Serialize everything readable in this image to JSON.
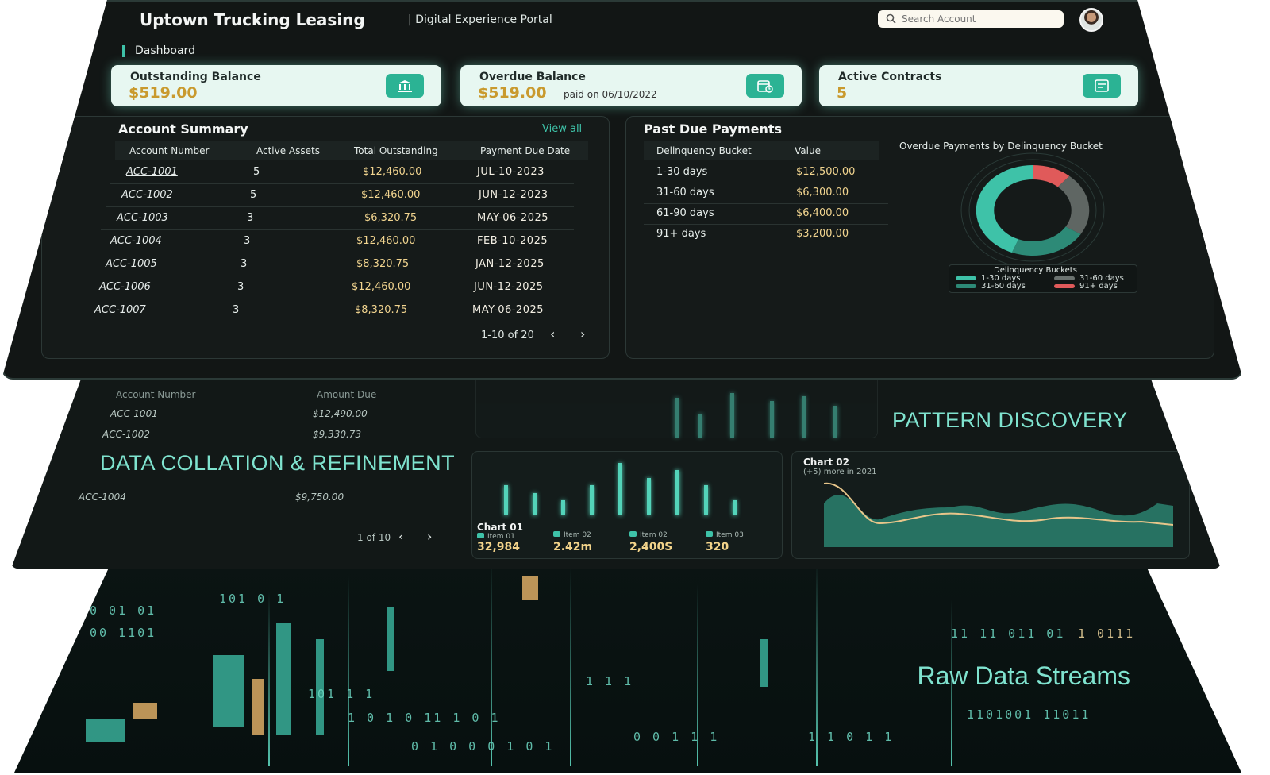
{
  "header": {
    "app_title": "Uptown Trucking Leasing",
    "portal_subtitle": "| Digital Experience Portal",
    "search_placeholder": "Search Account"
  },
  "breadcrumb": "Dashboard",
  "cards": [
    {
      "label": "Outstanding Balance",
      "value": "$519.00",
      "icon": "bank-icon"
    },
    {
      "label": "Overdue Balance",
      "value": "$519.00",
      "note": "paid on 06/10/2022",
      "icon": "calendar-clock-icon"
    },
    {
      "label": "Active Contracts",
      "value": "5",
      "icon": "contract-icon"
    }
  ],
  "account_summary": {
    "title": "Account Summary",
    "view_all": "View all",
    "columns": [
      "Account Number",
      "Active Assets",
      "Total Outstanding",
      "Payment Due Date"
    ],
    "rows": [
      {
        "account": "ACC-1001",
        "assets": "5",
        "outstanding": "$12,460.00",
        "due": "JUL-10-2023"
      },
      {
        "account": "ACC-1002",
        "assets": "5",
        "outstanding": "$12,460.00",
        "due": "JUN-12-2023"
      },
      {
        "account": "ACC-1003",
        "assets": "3",
        "outstanding": "$6,320.75",
        "due": "MAY-06-2025"
      },
      {
        "account": "ACC-1004",
        "assets": "3",
        "outstanding": "$12,460.00",
        "due": "FEB-10-2025"
      },
      {
        "account": "ACC-1005",
        "assets": "3",
        "outstanding": "$8,320.75",
        "due": "JAN-12-2025"
      },
      {
        "account": "ACC-1006",
        "assets": "3",
        "outstanding": "$12,460.00",
        "due": "JUN-12-2025"
      },
      {
        "account": "ACC-1007",
        "assets": "3",
        "outstanding": "$8,320.75",
        "due": "MAY-06-2025"
      }
    ],
    "pager": "1-10 of 20"
  },
  "past_due": {
    "title": "Past Due Payments",
    "columns": [
      "Delinquency Bucket",
      "Value"
    ],
    "rows": [
      {
        "bucket": "1-30 days",
        "value": "$12,500.00"
      },
      {
        "bucket": "31-60 days",
        "value": "$6,300.00"
      },
      {
        "bucket": "61-90 days",
        "value": "$6,400.00"
      },
      {
        "bucket": "91+ days",
        "value": "$3,200.00"
      }
    ],
    "chart_title": "Overdue Payments by Delinquency Bucket",
    "legend_title": "Delinquency Buckets",
    "legend": [
      {
        "label": "1-30 days",
        "color": "#3ec2a8"
      },
      {
        "label": "31-60 days",
        "color": "#6b7370"
      },
      {
        "label": "31-60 days",
        "color": "#2d8a77"
      },
      {
        "label": "91+ days",
        "color": "#e05a5a"
      }
    ]
  },
  "chart_data": {
    "type": "pie",
    "title": "Overdue Payments by Delinquency Bucket",
    "categories": [
      "1-30 days",
      "31-60 days",
      "61-90 days",
      "91+ days"
    ],
    "values": [
      12500,
      6300,
      6400,
      3200
    ],
    "colors": [
      "#3ec2a8",
      "#2d8a77",
      "#5f6663",
      "#e05a5a"
    ],
    "legend_position": "bottom"
  },
  "middle_layer": {
    "columns": [
      "Account Number",
      "Amount Due"
    ],
    "rows": [
      {
        "account": "ACC-1001",
        "amount": "$12,490.00"
      },
      {
        "account": "ACC-1002",
        "amount": "$9,330.73"
      },
      {
        "account": "ACC-1004",
        "amount": "$9,750.00"
      }
    ],
    "label_collation": "DATA COLLATION & REFINEMENT",
    "label_pattern": "PATTERN DISCOVERY",
    "pager": "1 of 10",
    "chart01": {
      "title": "Chart 01",
      "bars": [
        4,
        3,
        2,
        4,
        7,
        5,
        6,
        4,
        2
      ],
      "kpis": [
        {
          "label": "Item 01",
          "value": "32,984"
        },
        {
          "label": "Item 02",
          "value": "2.42m"
        },
        {
          "label": "Item 02",
          "value": "2,400S"
        },
        {
          "label": "Item 03",
          "value": "320"
        }
      ]
    },
    "chart02": {
      "title": "Chart 02",
      "subtitle": "(+5) more in 2021"
    }
  },
  "raw_layer": {
    "label": "Raw Data Streams",
    "binary": [
      "101 0 1",
      "0 01 01",
      "00 1101",
      "101 1 1",
      "1 1 1",
      "11 11 011 01",
      "1101001 11011",
      "1 0 1 0 11 1 0 1",
      "0 0 1 1 1",
      "1 0111",
      "1 1 0 1 1",
      "0 1 0 0 0 1 0 1"
    ]
  }
}
